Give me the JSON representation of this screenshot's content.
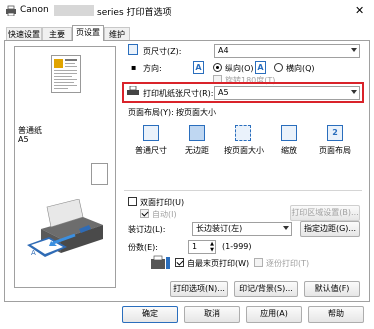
{
  "window": {
    "title_prefix": "Canon",
    "title_suffix": "series 打印首选项",
    "close_symbol": "✕"
  },
  "tabs": [
    {
      "label": "快速设置"
    },
    {
      "label": "主要"
    },
    {
      "label": "页设置"
    },
    {
      "label": "维护"
    }
  ],
  "preview": {
    "media_name": "普通纸",
    "paper_size": "A5"
  },
  "page_settings": {
    "page_size_label": "页尺寸(Z):",
    "page_size_value": "A4",
    "orientation_label": "方向:",
    "portrait_label": "纵向(O)",
    "landscape_label": "横向(Q)",
    "rotate_label": "旋转180度(T)",
    "printer_paper_size_label": "打印机纸张尺寸(R):",
    "printer_paper_size_value": "A5"
  },
  "page_layout": {
    "label": "页面布局(Y):",
    "current": "按页面大小",
    "options": [
      {
        "label": "普通尺寸"
      },
      {
        "label": "无边距"
      },
      {
        "label": "按页面大小"
      },
      {
        "label": "缩放"
      },
      {
        "label": "页面布局"
      }
    ],
    "page_layout_number": "2"
  },
  "duplex": {
    "label": "双面打印(U)",
    "auto_label": "自动(I)",
    "print_area_button": "打印区域设置(B)...",
    "stapling_label": "装订边(L):",
    "stapling_value": "长边装订(左)",
    "margin_button": "指定边距(G)..."
  },
  "copies": {
    "label": "份数(E):",
    "value": "1",
    "range": "(1-999)",
    "collate_label": "自最末页打印(W)",
    "reverse_label": "逐份打印(T)"
  },
  "bottom_buttons": {
    "print_options": "打印选项(N)...",
    "stamp_background": "印记/背景(S)...",
    "defaults": "默认值(F)"
  },
  "dialog_buttons": {
    "ok": "确定",
    "cancel": "取消",
    "apply": "应用(A)",
    "help": "帮助"
  },
  "colors": {
    "highlight_border": "#d9232a",
    "accent": "#2a6ebd"
  }
}
